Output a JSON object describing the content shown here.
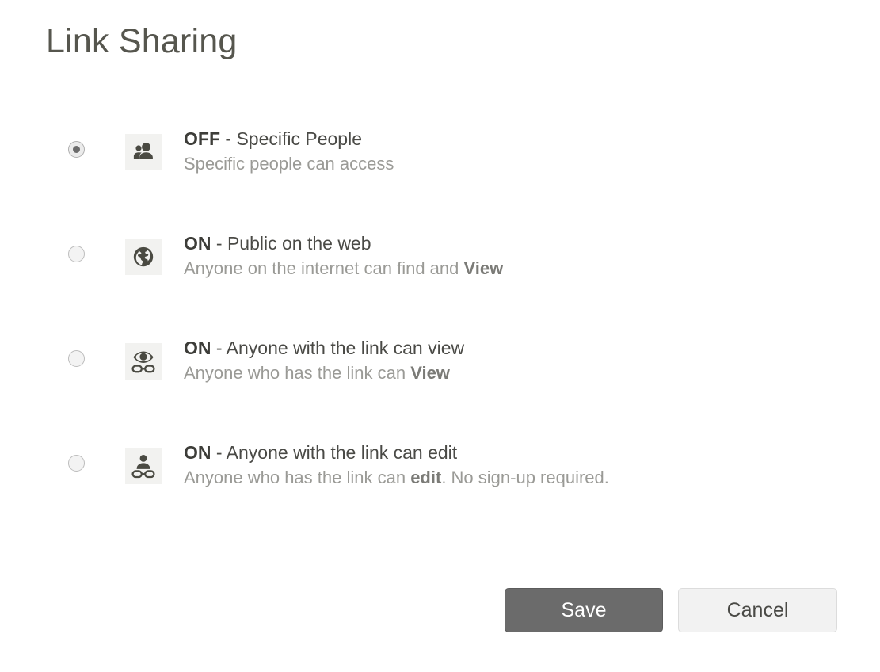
{
  "dialog": {
    "title": "Link Sharing"
  },
  "options": [
    {
      "id": "specific-people",
      "selected": true,
      "icon": "people-icon",
      "state": "OFF",
      "separator": " - ",
      "title": "Specific People",
      "sub_prefix": "Specific people can access",
      "sub_bold": "",
      "sub_suffix": ""
    },
    {
      "id": "public-on-the-web",
      "selected": false,
      "icon": "globe-icon",
      "state": "ON",
      "separator": " - ",
      "title": "Public on the web",
      "sub_prefix": "Anyone on the internet can find and ",
      "sub_bold": "View",
      "sub_suffix": ""
    },
    {
      "id": "anyone-with-link-can-view",
      "selected": false,
      "icon": "eye-link-icon",
      "state": "ON",
      "separator": " - ",
      "title": "Anyone with the link can view",
      "sub_prefix": "Anyone who has the link can ",
      "sub_bold": "View",
      "sub_suffix": ""
    },
    {
      "id": "anyone-with-link-can-edit",
      "selected": false,
      "icon": "person-link-icon",
      "state": "ON",
      "separator": " - ",
      "title": "Anyone with the link can edit",
      "sub_prefix": "Anyone who has the link can ",
      "sub_bold": "edit",
      "sub_suffix": ". No sign-up required."
    }
  ],
  "footer": {
    "save_label": "Save",
    "cancel_label": "Cancel"
  },
  "colors": {
    "title_text": "#56564e",
    "option_title_text": "#4a4a46",
    "option_sub_text": "#9a9a96",
    "icon_tile_bg": "#f2f2f0",
    "icon_fill": "#4a4a42",
    "save_bg": "#6b6b6b",
    "save_text": "#ffffff",
    "cancel_bg": "#f2f2f2",
    "cancel_text": "#4a4a46",
    "divider": "#e8e8e8",
    "page_bg": "#ffffff"
  }
}
